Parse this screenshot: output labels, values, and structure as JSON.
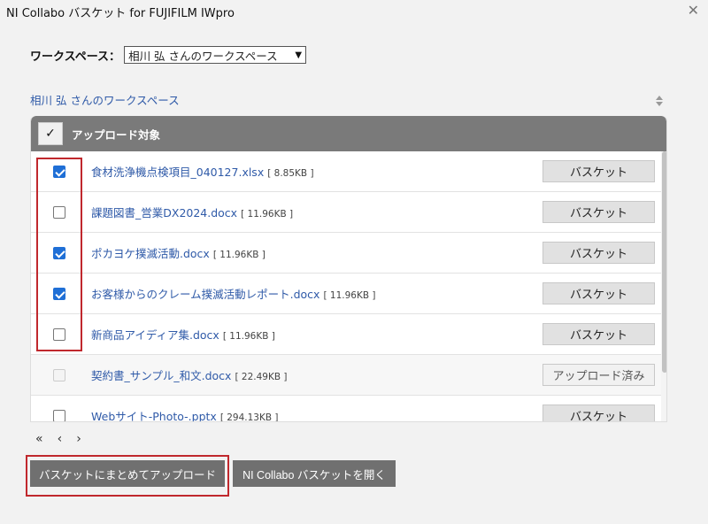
{
  "window": {
    "title": "NI Collabo バスケット for FUJIFILM IWpro",
    "close_icon": "close-icon"
  },
  "workspace": {
    "label": "ワークスペース：",
    "selected": "相川 弘 さんのワークスペース"
  },
  "breadcrumb": "相川 弘 さんのワークスペース",
  "table": {
    "header_label": "アップロード対象",
    "header_check": "✓",
    "rows": [
      {
        "name": "食材洗浄機点検項目_040127.xlsx",
        "size": "[ 8.85KB ]",
        "checked": true,
        "button": "バスケット"
      },
      {
        "name": "課題図書_営業DX2024.docx",
        "size": "[ 11.96KB ]",
        "checked": false,
        "button": "バスケット"
      },
      {
        "name": "ポカヨケ撲滅活動.docx",
        "size": "[ 11.96KB ]",
        "checked": true,
        "button": "バスケット"
      },
      {
        "name": "お客様からのクレーム撲滅活動レポート.docx",
        "size": "[ 11.96KB ]",
        "checked": true,
        "button": "バスケット"
      },
      {
        "name": "新商品アイディア集.docx",
        "size": "[ 11.96KB ]",
        "checked": false,
        "button": "バスケット"
      },
      {
        "name": "契約書_サンプル_和文.docx",
        "size": "[ 22.49KB ]",
        "checked": false,
        "disabled": true,
        "button": "アップロード済み"
      },
      {
        "name": "Webサイト-Photo-.pptx",
        "size": "[ 294.13KB ]",
        "checked": false,
        "button": "バスケット"
      }
    ]
  },
  "pager": {
    "first": "«",
    "prev": "‹",
    "next": "›"
  },
  "buttons": {
    "upload_all": "バスケットにまとめてアップロード",
    "open_basket": "NI Collabo バスケットを開く"
  },
  "colors": {
    "accent_mark": "#c0282d",
    "link": "#2f5aa8",
    "header_bg": "#7a7a7a"
  }
}
